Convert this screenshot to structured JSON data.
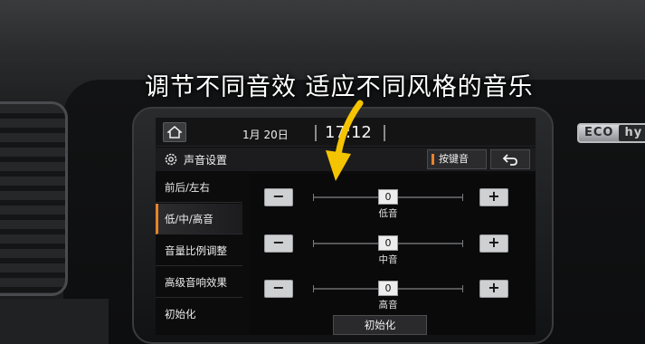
{
  "overlay": {
    "caption": "调节不同音效 适应不同风格的音乐"
  },
  "car": {
    "badge_eco": "ECO",
    "badge_hy": "hy"
  },
  "statusbar": {
    "home_icon": "home-icon",
    "date": "1月 20日",
    "time": "17:12"
  },
  "titlebar": {
    "settings_icon": "gear-icon",
    "title": "声音设置",
    "keytone_label": "按键音",
    "back_icon": "back-arrow-icon"
  },
  "menu": {
    "items": [
      {
        "label": "前后/左右",
        "active": false
      },
      {
        "label": "低/中/高音",
        "active": true
      },
      {
        "label": "音量比例调整",
        "active": false
      },
      {
        "label": "高级音响效果",
        "active": false
      },
      {
        "label": "初始化",
        "active": false
      }
    ]
  },
  "equalizer": {
    "rows": [
      {
        "label": "低音",
        "value": "0",
        "minus": "−",
        "plus": "+"
      },
      {
        "label": "中音",
        "value": "0",
        "minus": "−",
        "plus": "+"
      },
      {
        "label": "高音",
        "value": "0",
        "minus": "−",
        "plus": "+"
      }
    ],
    "reset_label": "初始化"
  },
  "colors": {
    "accent": "#e8832a",
    "arrow": "#f5c400"
  }
}
